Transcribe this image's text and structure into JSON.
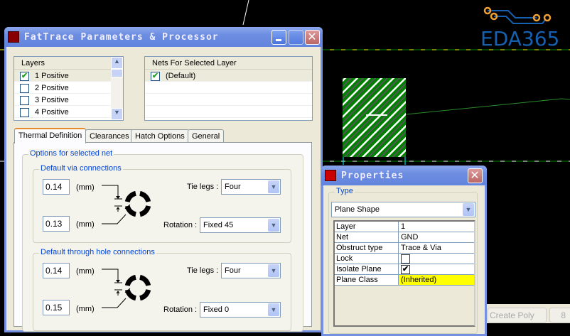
{
  "logo": {
    "text": "EDA365"
  },
  "fattrace": {
    "title": "FatTrace Parameters & Processor",
    "layers": {
      "header": "Layers",
      "items": [
        {
          "label": "1 Positive",
          "checked": true
        },
        {
          "label": "2 Positive",
          "checked": false
        },
        {
          "label": "3 Positive",
          "checked": false
        },
        {
          "label": "4 Positive",
          "checked": false
        }
      ]
    },
    "nets": {
      "header": "Nets For Selected Layer",
      "items": [
        {
          "label": "(Default)",
          "checked": true
        }
      ]
    },
    "tabs": [
      "Thermal Definition",
      "Clearances",
      "Hatch Options",
      "General"
    ],
    "options_title": "Options for selected net",
    "via": {
      "title": "Default via connections",
      "val1": "0.14",
      "val2": "0.13",
      "unit": "(mm)",
      "tie_label": "Tie legs :",
      "tie": "Four",
      "rot_label": "Rotation :",
      "rot": "Fixed 45"
    },
    "th": {
      "title": "Default through hole connections",
      "val1": "0.14",
      "val2": "0.15",
      "unit": "(mm)",
      "tie_label": "Tie legs :",
      "tie": "Four",
      "rot_label": "Rotation :",
      "rot": "Fixed 0"
    }
  },
  "properties": {
    "title": "Properties",
    "type_label": "Type",
    "type": "Plane Shape",
    "rows": [
      [
        "Layer",
        "1"
      ],
      [
        "Net",
        "GND"
      ],
      [
        "Obstruct type",
        "Trace & Via"
      ],
      [
        "Lock",
        ""
      ],
      [
        "Isolate Plane",
        ""
      ],
      [
        "Plane Class",
        "(Inherited)"
      ]
    ],
    "highlight": "#ffff00"
  },
  "status": {
    "create_poly": "Create Poly",
    "other": "8"
  }
}
